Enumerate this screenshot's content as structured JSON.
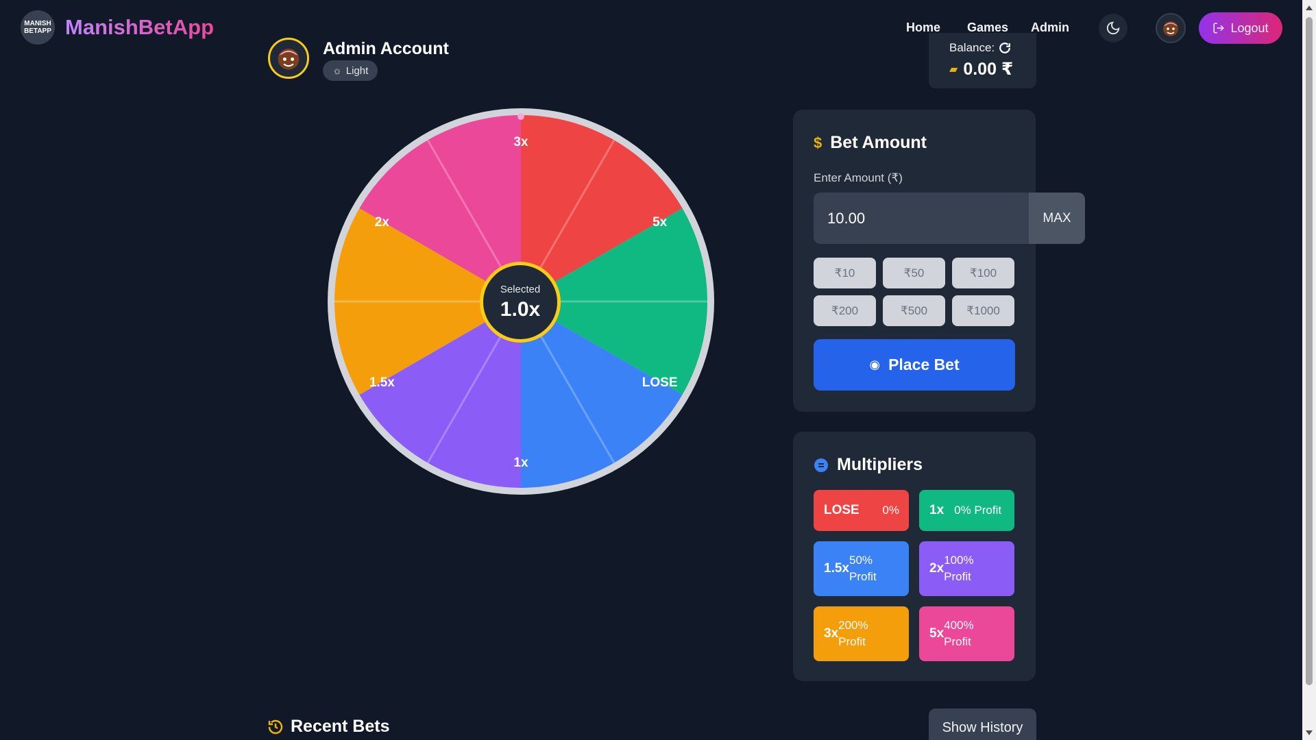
{
  "header": {
    "logo_text_line1": "MANISH",
    "logo_text_line2": "BETAPP",
    "app_title": "ManishBetApp",
    "nav": [
      "Home",
      "Games",
      "Admin"
    ],
    "logout_label": "Logout"
  },
  "account": {
    "name": "Admin Account",
    "theme_label": "Light"
  },
  "balance": {
    "label": "Balance:",
    "value": "0.00 ₹"
  },
  "wheel": {
    "selected_label": "Selected",
    "selected_value": "1.0x",
    "segments": [
      {
        "label": "3x",
        "color": "#ef4444"
      },
      {
        "label": "5x",
        "color": "#10b981"
      },
      {
        "label": "LOSE",
        "color": "#3b82f6"
      },
      {
        "label": "1x",
        "color": "#8b5cf6"
      },
      {
        "label": "1.5x",
        "color": "#f59e0b"
      },
      {
        "label": "2x",
        "color": "#ec4899"
      }
    ]
  },
  "bet": {
    "title": "Bet Amount",
    "amount_label": "Enter Amount (₹)",
    "amount_value": "10.00",
    "max_label": "MAX",
    "quick_amounts": [
      "₹10",
      "₹50",
      "₹100",
      "₹200",
      "₹500",
      "₹1000"
    ],
    "place_label": "Place Bet"
  },
  "multipliers": {
    "title": "Multipliers",
    "items": [
      {
        "key": "LOSE",
        "desc": "0%",
        "color": "#ef4444"
      },
      {
        "key": "1x",
        "desc": "0% Profit",
        "color": "#10b981"
      },
      {
        "key": "1.5x",
        "desc": "50% Profit",
        "color": "#3b82f6"
      },
      {
        "key": "2x",
        "desc": "100% Profit",
        "color": "#8b5cf6"
      },
      {
        "key": "3x",
        "desc": "200% Profit",
        "color": "#f59e0b"
      },
      {
        "key": "5x",
        "desc": "400% Profit",
        "color": "#ec4899"
      }
    ]
  },
  "recent": {
    "title": "Recent Bets",
    "history_label": "Show History"
  }
}
